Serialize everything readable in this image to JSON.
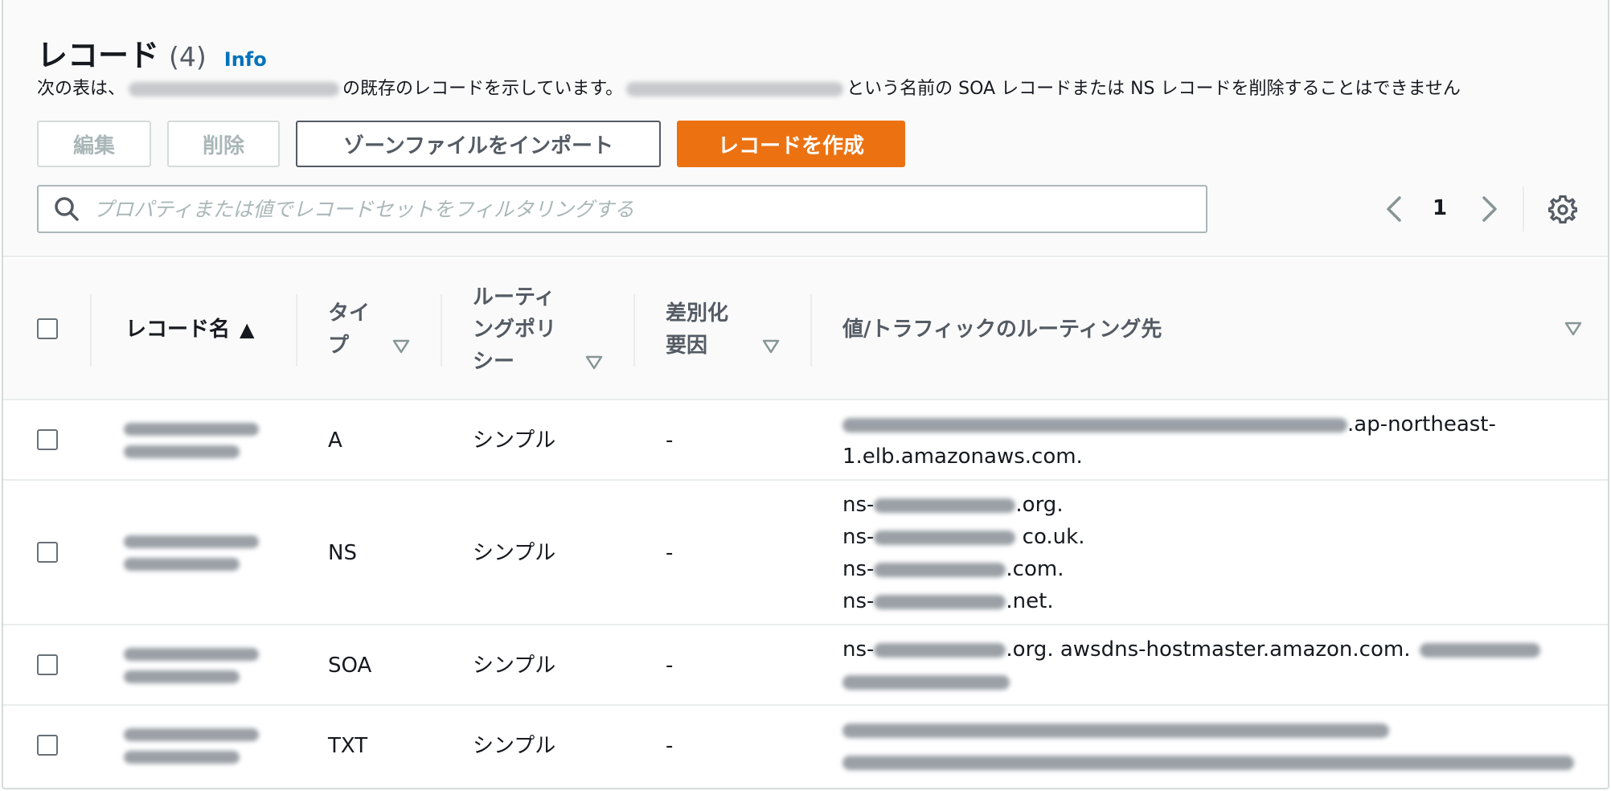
{
  "header": {
    "title": "レコード",
    "count": "(4)",
    "info": "Info",
    "desc_prefix": "次の表は、",
    "desc_middle": "の既存のレコードを示しています。",
    "desc_suffix": "という名前の SOA レコードまたは NS レコードを削除することはできません"
  },
  "toolbar": {
    "edit_label": "編集",
    "delete_label": "削除",
    "import_label": "ゾーンファイルをインポート",
    "create_label": "レコードを作成"
  },
  "search": {
    "placeholder": "プロパティまたは値でレコードセットをフィルタリングする",
    "value": ""
  },
  "pagination": {
    "current_page": "1"
  },
  "table": {
    "columns": {
      "name": "レコード名",
      "name_sort_icon": "▲",
      "type_l1": "タイ",
      "type_l2": "プ",
      "routing_l1": "ルーティ",
      "routing_l2": "ングポリ",
      "routing_l3": "シー",
      "diff_l1": "差別化",
      "diff_l2": "要因",
      "value": "値/トラフィックのルーティング先"
    },
    "rows": [
      {
        "type": "A",
        "routing": "シンプル",
        "diff": "-",
        "value_l1_suffix": ".ap-northeast-",
        "value_l2": "1.elb.amazonaws.com."
      },
      {
        "type": "NS",
        "routing": "シンプル",
        "diff": "-",
        "ns1_prefix": "ns-",
        "ns1_suffix": ".org.",
        "ns2_prefix": "ns-",
        "ns2_suffix": " co.uk.",
        "ns3_prefix": "ns-",
        "ns3_suffix": ".com.",
        "ns4_prefix": "ns-",
        "ns4_suffix": ".net."
      },
      {
        "type": "SOA",
        "routing": "シンプル",
        "diff": "-",
        "value_prefix": "ns-",
        "value_middle": ".org. awsdns-hostmaster.amazon.com."
      },
      {
        "type": "TXT",
        "routing": "シンプル",
        "diff": "-"
      }
    ]
  },
  "colors": {
    "primary": "#ec7211",
    "link": "#0073bb",
    "border": "#d5dbdb",
    "text": "#16191f",
    "muted": "#545b64"
  }
}
